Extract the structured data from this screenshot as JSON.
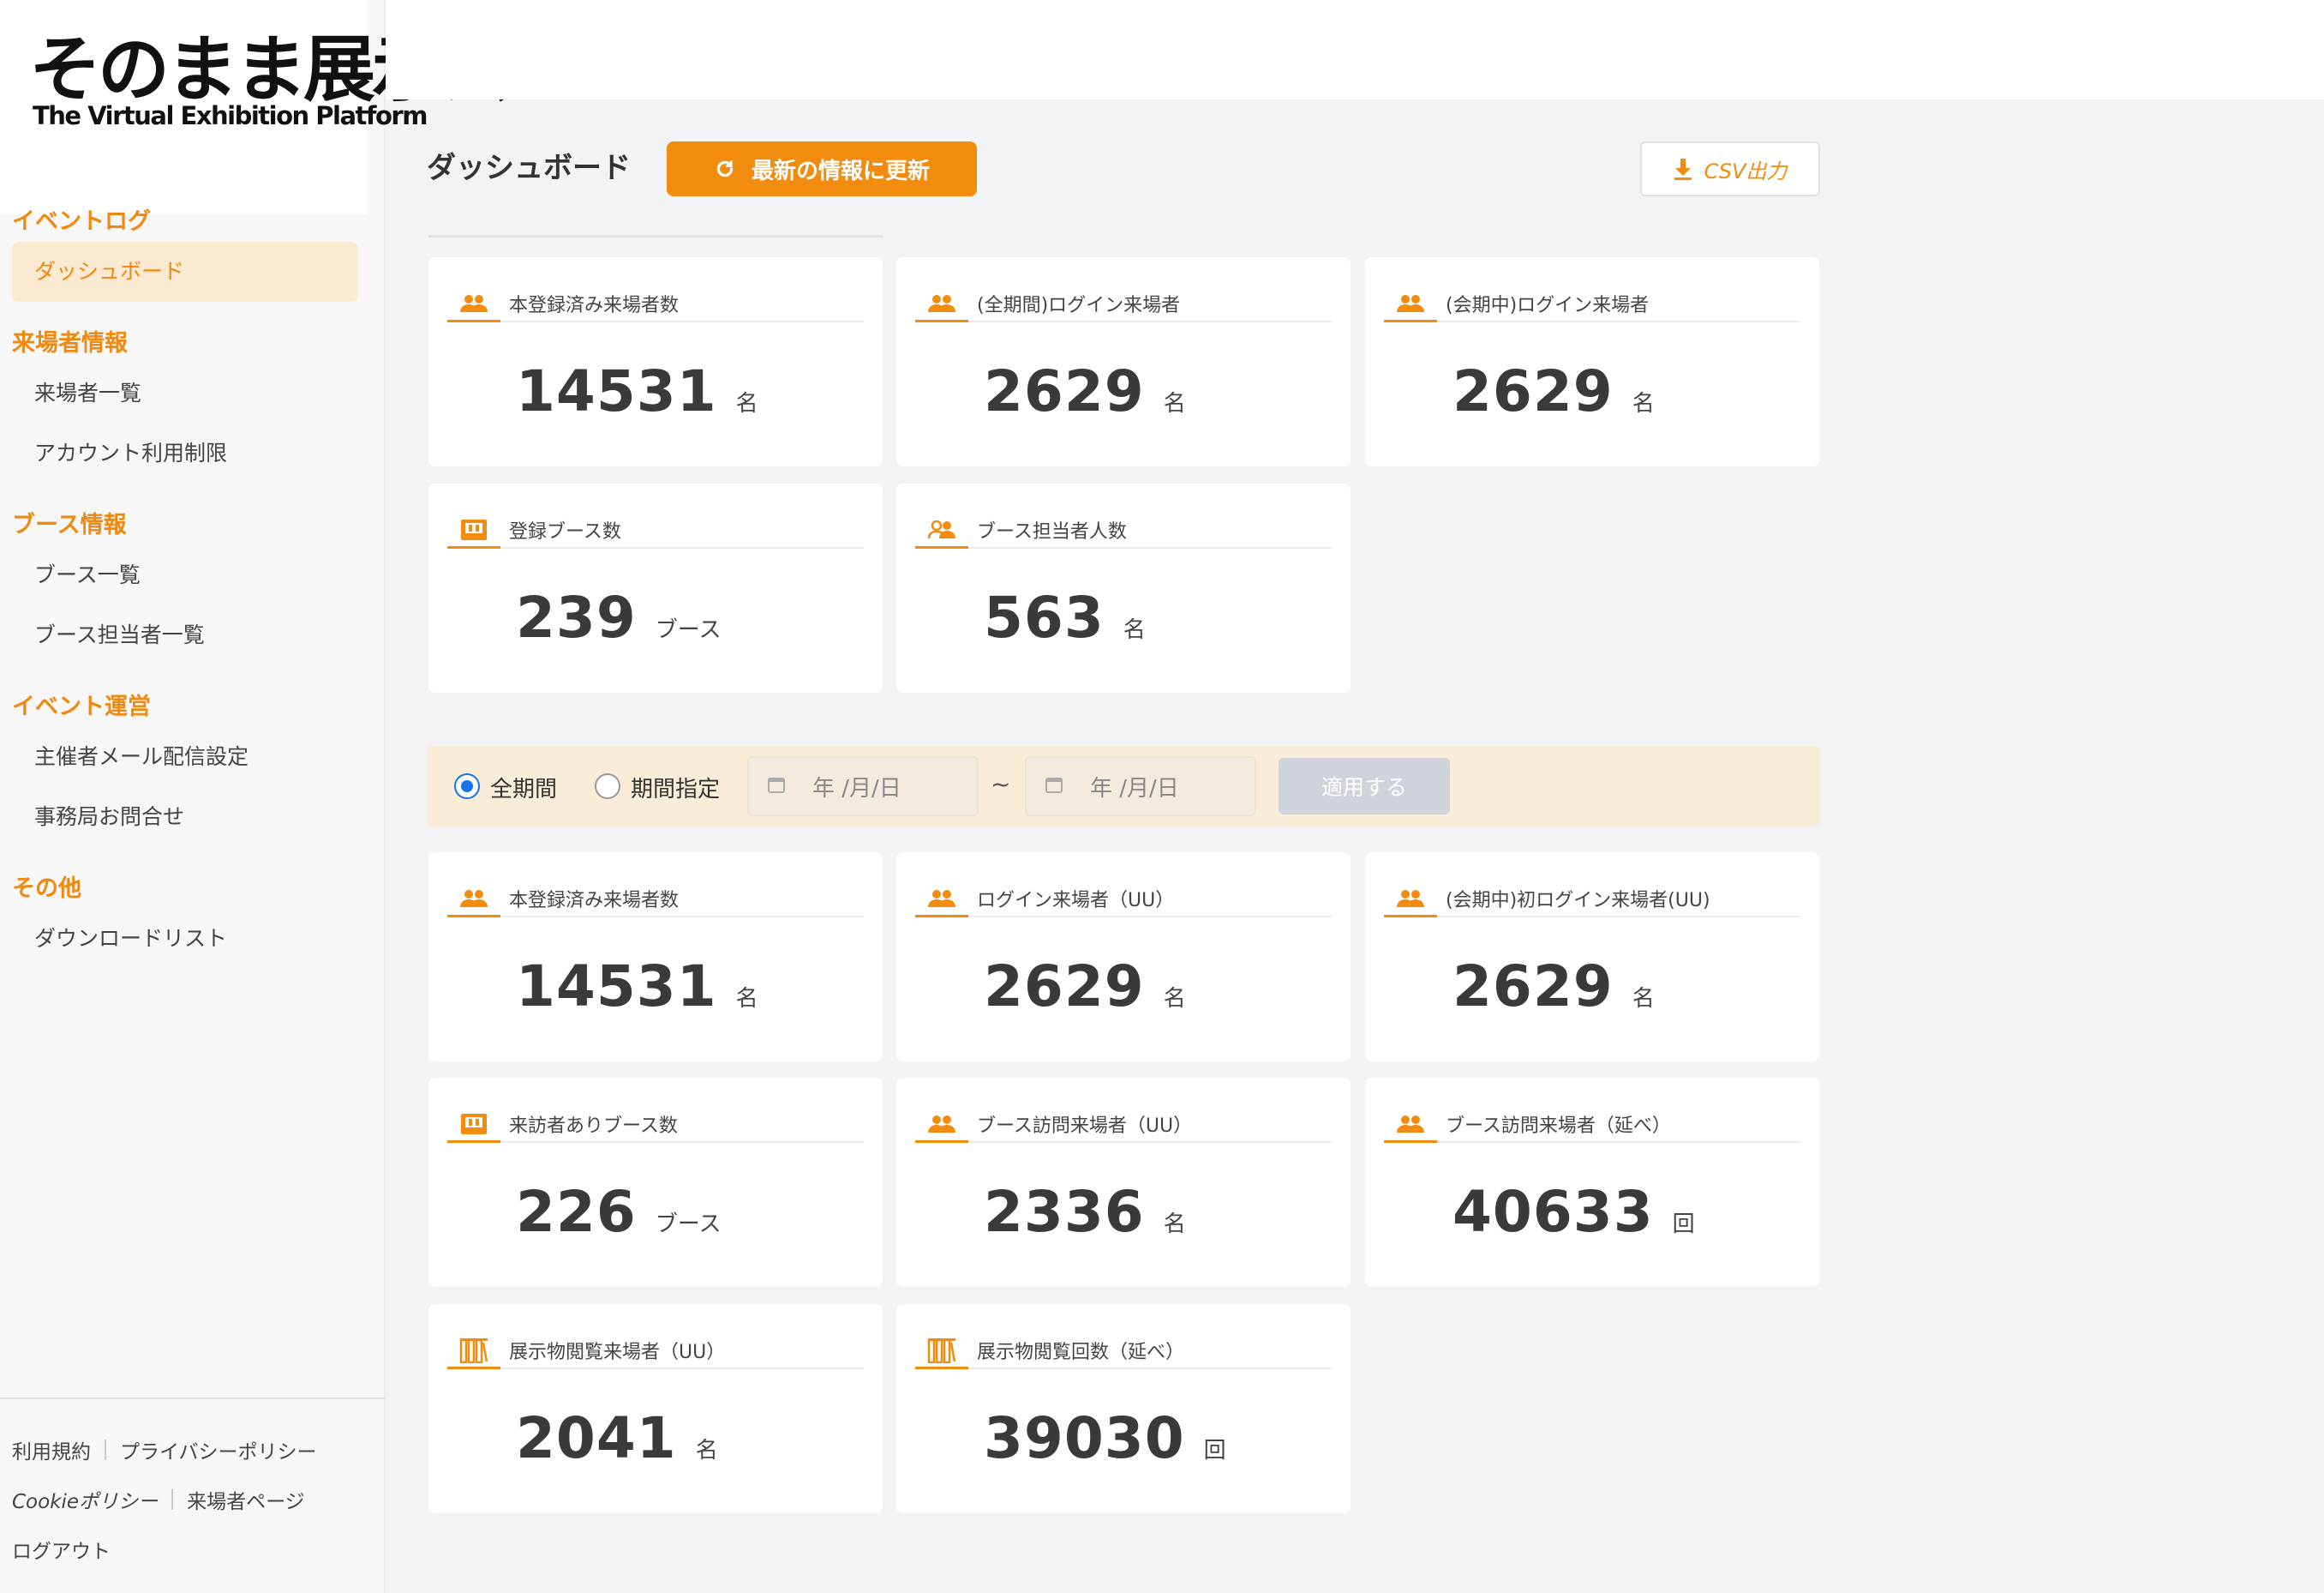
{
  "logo": {
    "main": "そのまま展示会",
    "sub": "The Virtual Exhibition Platform"
  },
  "sidebar": {
    "sections": [
      {
        "title": "イベントログ",
        "items": [
          {
            "label": "ダッシュボード",
            "active": true
          }
        ]
      },
      {
        "title": "来場者情報",
        "items": [
          {
            "label": "来場者一覧"
          },
          {
            "label": "アカウント利用制限"
          }
        ]
      },
      {
        "title": "ブース情報",
        "items": [
          {
            "label": "ブース一覧"
          },
          {
            "label": "ブース担当者一覧"
          }
        ]
      },
      {
        "title": "イベント運営",
        "items": [
          {
            "label": "主催者メール配信設定"
          },
          {
            "label": "事務局お問合せ"
          }
        ]
      },
      {
        "title": "その他",
        "items": [
          {
            "label": "ダウンロードリスト"
          }
        ]
      }
    ],
    "footer": {
      "terms": "利用規約",
      "privacy": "プライバシーポリシー",
      "cookie": "Cookieポリシー",
      "visitor_page": "来場者ページ",
      "logout": "ログアウト"
    }
  },
  "header": {
    "title": "ダッシュボード",
    "refresh_label": "最新の情報に更新",
    "csv_label": "CSV出力"
  },
  "summary_cards": [
    {
      "icon": "people-icon",
      "label": "本登録済み来場者数",
      "value": "14531",
      "unit": "名"
    },
    {
      "icon": "people-icon",
      "label": "(全期間)ログイン来場者",
      "value": "2629",
      "unit": "名"
    },
    {
      "icon": "people-icon",
      "label": "(会期中)ログイン来場者",
      "value": "2629",
      "unit": "名"
    },
    {
      "icon": "booth-icon",
      "label": "登録ブース数",
      "value": "239",
      "unit": "ブース"
    },
    {
      "icon": "staff-icon",
      "label": "ブース担当者人数",
      "value": "563",
      "unit": "名"
    }
  ],
  "filter": {
    "all_period": "全期間",
    "range": "期間指定",
    "date_placeholder": "年 /月/日",
    "tilde": "~",
    "apply": "適用する",
    "selected": "all_period"
  },
  "period_cards": [
    {
      "icon": "people-icon",
      "label": "本登録済み来場者数",
      "value": "14531",
      "unit": "名"
    },
    {
      "icon": "people-icon",
      "label": "ログイン来場者（UU）",
      "value": "2629",
      "unit": "名"
    },
    {
      "icon": "people-icon",
      "label": "(会期中)初ログイン来場者(UU)",
      "value": "2629",
      "unit": "名"
    },
    {
      "icon": "booth-icon",
      "label": "来訪者ありブース数",
      "value": "226",
      "unit": "ブース"
    },
    {
      "icon": "people-icon",
      "label": "ブース訪問来場者（UU）",
      "value": "2336",
      "unit": "名"
    },
    {
      "icon": "people-icon",
      "label": "ブース訪問来場者（延べ）",
      "value": "40633",
      "unit": "回"
    },
    {
      "icon": "books-icon",
      "label": "展示物閲覧来場者（UU）",
      "value": "2041",
      "unit": "名"
    },
    {
      "icon": "books-icon",
      "label": "展示物閲覧回数（延べ）",
      "value": "39030",
      "unit": "回"
    }
  ],
  "colors": {
    "accent": "#f28c0f",
    "radio": "#1a73e8",
    "filter_bg": "#f9edd8"
  }
}
